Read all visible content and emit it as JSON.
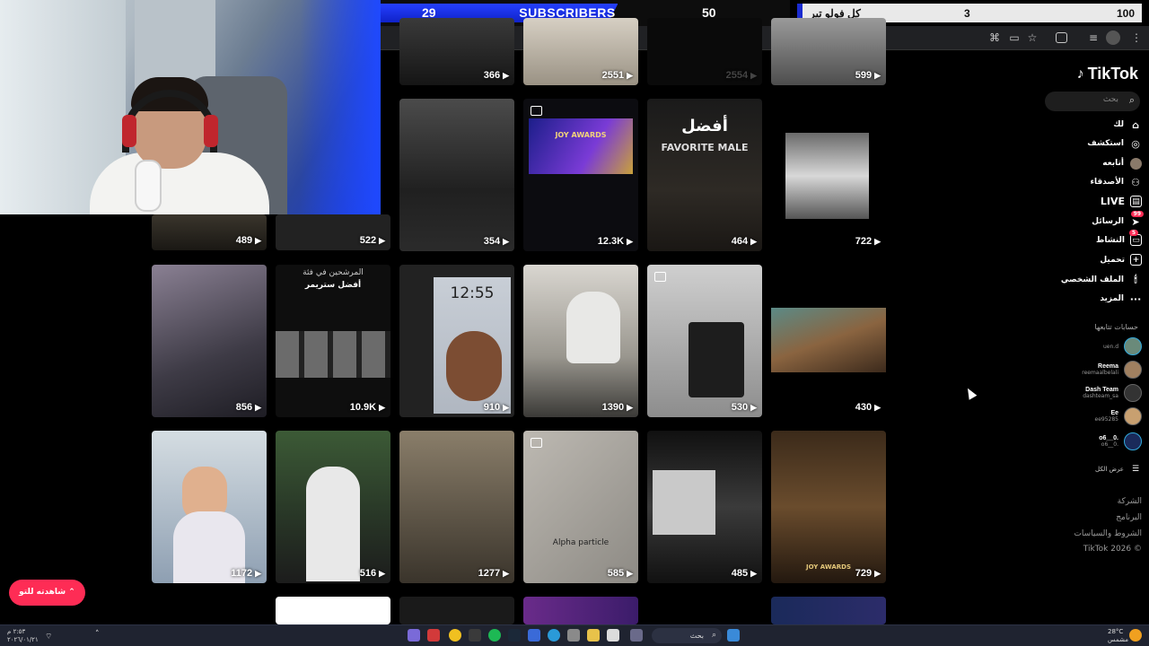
{
  "overlay": {
    "subscribers": {
      "current": "29",
      "label": "SUBSCRIBERS",
      "target": "50",
      "progress": 0.58
    },
    "goal": {
      "title": "كل فولو تير",
      "count": "3",
      "target": "100"
    }
  },
  "tiktok": {
    "logo": "TikTok",
    "search_placeholder": "بحث",
    "nav": [
      {
        "label": "لك",
        "icon": "home-icon"
      },
      {
        "label": "استكشف",
        "icon": "compass-icon"
      },
      {
        "label": "أتابعه",
        "icon": "avatar-icon"
      },
      {
        "label": "الأصدقاء",
        "icon": "friends-icon"
      },
      {
        "label": "LIVE",
        "icon": "live-icon"
      },
      {
        "label": "الرسائل",
        "icon": "messages-icon",
        "badge": "99"
      },
      {
        "label": "النشاط",
        "icon": "activity-icon",
        "badge": "5"
      },
      {
        "label": "تحميل",
        "icon": "upload-icon"
      },
      {
        "label": "الملف الشخصي",
        "icon": "profile-icon"
      },
      {
        "label": "المزيد",
        "icon": "more-icon"
      }
    ],
    "following_header": "حسابات تتابعها",
    "accounts": [
      {
        "name": "",
        "handle": "uen.d"
      },
      {
        "name": "Reema",
        "handle": "reemaalbelali"
      },
      {
        "name": "Dash Team",
        "handle": "dashteam_sa"
      },
      {
        "name": "Ee",
        "handle": "ee95285"
      },
      {
        "name": "o6__0.",
        "handle": "o6__0."
      }
    ],
    "show_all": "عرض الكل",
    "footer": [
      "الشركة",
      "البرنامج",
      "الشروط والسياسات",
      "TikTok 2026 ©"
    ],
    "watch_button": "شاهدته للتو"
  },
  "grid": {
    "row0": [
      "366",
      "2551",
      "2554",
      "599"
    ],
    "row1": [
      "489",
      "522",
      "354",
      "12.3K",
      "464",
      "722"
    ],
    "row2": [
      "856",
      "10.9K",
      "910",
      "1390",
      "530",
      "430"
    ],
    "row3": [
      "1172",
      "516",
      "1277",
      "585",
      "485",
      "729"
    ],
    "captions": {
      "favorite": "FAVORITE MALE",
      "favorite_ar": "أفضل",
      "nominees_ar": "المرشحين في فئة",
      "best_streamer_ar": "أفضل ستريمر",
      "phone_time": "12:55",
      "joy_awards": "JOY AWARDS",
      "alpha": "Alpha particle"
    }
  },
  "taskbar": {
    "search": "بحث",
    "weather": "28°C",
    "weather_desc": "مشمس",
    "time": "٢:٥٣ م",
    "date": "٢٠٢٦/٠١/٢١"
  }
}
